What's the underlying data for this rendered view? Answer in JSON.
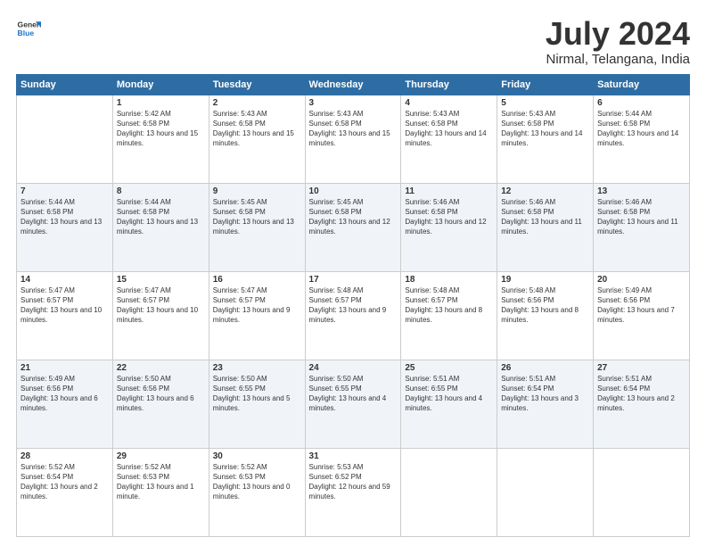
{
  "logo": {
    "line1": "General",
    "line2": "Blue"
  },
  "title": "July 2024",
  "location": "Nirmal, Telangana, India",
  "header": {
    "days": [
      "Sunday",
      "Monday",
      "Tuesday",
      "Wednesday",
      "Thursday",
      "Friday",
      "Saturday"
    ]
  },
  "weeks": [
    [
      {
        "day": "",
        "sunrise": "",
        "sunset": "",
        "daylight": ""
      },
      {
        "day": "1",
        "sunrise": "Sunrise: 5:42 AM",
        "sunset": "Sunset: 6:58 PM",
        "daylight": "Daylight: 13 hours and 15 minutes."
      },
      {
        "day": "2",
        "sunrise": "Sunrise: 5:43 AM",
        "sunset": "Sunset: 6:58 PM",
        "daylight": "Daylight: 13 hours and 15 minutes."
      },
      {
        "day": "3",
        "sunrise": "Sunrise: 5:43 AM",
        "sunset": "Sunset: 6:58 PM",
        "daylight": "Daylight: 13 hours and 15 minutes."
      },
      {
        "day": "4",
        "sunrise": "Sunrise: 5:43 AM",
        "sunset": "Sunset: 6:58 PM",
        "daylight": "Daylight: 13 hours and 14 minutes."
      },
      {
        "day": "5",
        "sunrise": "Sunrise: 5:43 AM",
        "sunset": "Sunset: 6:58 PM",
        "daylight": "Daylight: 13 hours and 14 minutes."
      },
      {
        "day": "6",
        "sunrise": "Sunrise: 5:44 AM",
        "sunset": "Sunset: 6:58 PM",
        "daylight": "Daylight: 13 hours and 14 minutes."
      }
    ],
    [
      {
        "day": "7",
        "sunrise": "Sunrise: 5:44 AM",
        "sunset": "Sunset: 6:58 PM",
        "daylight": "Daylight: 13 hours and 13 minutes."
      },
      {
        "day": "8",
        "sunrise": "Sunrise: 5:44 AM",
        "sunset": "Sunset: 6:58 PM",
        "daylight": "Daylight: 13 hours and 13 minutes."
      },
      {
        "day": "9",
        "sunrise": "Sunrise: 5:45 AM",
        "sunset": "Sunset: 6:58 PM",
        "daylight": "Daylight: 13 hours and 13 minutes."
      },
      {
        "day": "10",
        "sunrise": "Sunrise: 5:45 AM",
        "sunset": "Sunset: 6:58 PM",
        "daylight": "Daylight: 13 hours and 12 minutes."
      },
      {
        "day": "11",
        "sunrise": "Sunrise: 5:46 AM",
        "sunset": "Sunset: 6:58 PM",
        "daylight": "Daylight: 13 hours and 12 minutes."
      },
      {
        "day": "12",
        "sunrise": "Sunrise: 5:46 AM",
        "sunset": "Sunset: 6:58 PM",
        "daylight": "Daylight: 13 hours and 11 minutes."
      },
      {
        "day": "13",
        "sunrise": "Sunrise: 5:46 AM",
        "sunset": "Sunset: 6:58 PM",
        "daylight": "Daylight: 13 hours and 11 minutes."
      }
    ],
    [
      {
        "day": "14",
        "sunrise": "Sunrise: 5:47 AM",
        "sunset": "Sunset: 6:57 PM",
        "daylight": "Daylight: 13 hours and 10 minutes."
      },
      {
        "day": "15",
        "sunrise": "Sunrise: 5:47 AM",
        "sunset": "Sunset: 6:57 PM",
        "daylight": "Daylight: 13 hours and 10 minutes."
      },
      {
        "day": "16",
        "sunrise": "Sunrise: 5:47 AM",
        "sunset": "Sunset: 6:57 PM",
        "daylight": "Daylight: 13 hours and 9 minutes."
      },
      {
        "day": "17",
        "sunrise": "Sunrise: 5:48 AM",
        "sunset": "Sunset: 6:57 PM",
        "daylight": "Daylight: 13 hours and 9 minutes."
      },
      {
        "day": "18",
        "sunrise": "Sunrise: 5:48 AM",
        "sunset": "Sunset: 6:57 PM",
        "daylight": "Daylight: 13 hours and 8 minutes."
      },
      {
        "day": "19",
        "sunrise": "Sunrise: 5:48 AM",
        "sunset": "Sunset: 6:56 PM",
        "daylight": "Daylight: 13 hours and 8 minutes."
      },
      {
        "day": "20",
        "sunrise": "Sunrise: 5:49 AM",
        "sunset": "Sunset: 6:56 PM",
        "daylight": "Daylight: 13 hours and 7 minutes."
      }
    ],
    [
      {
        "day": "21",
        "sunrise": "Sunrise: 5:49 AM",
        "sunset": "Sunset: 6:56 PM",
        "daylight": "Daylight: 13 hours and 6 minutes."
      },
      {
        "day": "22",
        "sunrise": "Sunrise: 5:50 AM",
        "sunset": "Sunset: 6:56 PM",
        "daylight": "Daylight: 13 hours and 6 minutes."
      },
      {
        "day": "23",
        "sunrise": "Sunrise: 5:50 AM",
        "sunset": "Sunset: 6:55 PM",
        "daylight": "Daylight: 13 hours and 5 minutes."
      },
      {
        "day": "24",
        "sunrise": "Sunrise: 5:50 AM",
        "sunset": "Sunset: 6:55 PM",
        "daylight": "Daylight: 13 hours and 4 minutes."
      },
      {
        "day": "25",
        "sunrise": "Sunrise: 5:51 AM",
        "sunset": "Sunset: 6:55 PM",
        "daylight": "Daylight: 13 hours and 4 minutes."
      },
      {
        "day": "26",
        "sunrise": "Sunrise: 5:51 AM",
        "sunset": "Sunset: 6:54 PM",
        "daylight": "Daylight: 13 hours and 3 minutes."
      },
      {
        "day": "27",
        "sunrise": "Sunrise: 5:51 AM",
        "sunset": "Sunset: 6:54 PM",
        "daylight": "Daylight: 13 hours and 2 minutes."
      }
    ],
    [
      {
        "day": "28",
        "sunrise": "Sunrise: 5:52 AM",
        "sunset": "Sunset: 6:54 PM",
        "daylight": "Daylight: 13 hours and 2 minutes."
      },
      {
        "day": "29",
        "sunrise": "Sunrise: 5:52 AM",
        "sunset": "Sunset: 6:53 PM",
        "daylight": "Daylight: 13 hours and 1 minute."
      },
      {
        "day": "30",
        "sunrise": "Sunrise: 5:52 AM",
        "sunset": "Sunset: 6:53 PM",
        "daylight": "Daylight: 13 hours and 0 minutes."
      },
      {
        "day": "31",
        "sunrise": "Sunrise: 5:53 AM",
        "sunset": "Sunset: 6:52 PM",
        "daylight": "Daylight: 12 hours and 59 minutes."
      },
      {
        "day": "",
        "sunrise": "",
        "sunset": "",
        "daylight": ""
      },
      {
        "day": "",
        "sunrise": "",
        "sunset": "",
        "daylight": ""
      },
      {
        "day": "",
        "sunrise": "",
        "sunset": "",
        "daylight": ""
      }
    ]
  ]
}
